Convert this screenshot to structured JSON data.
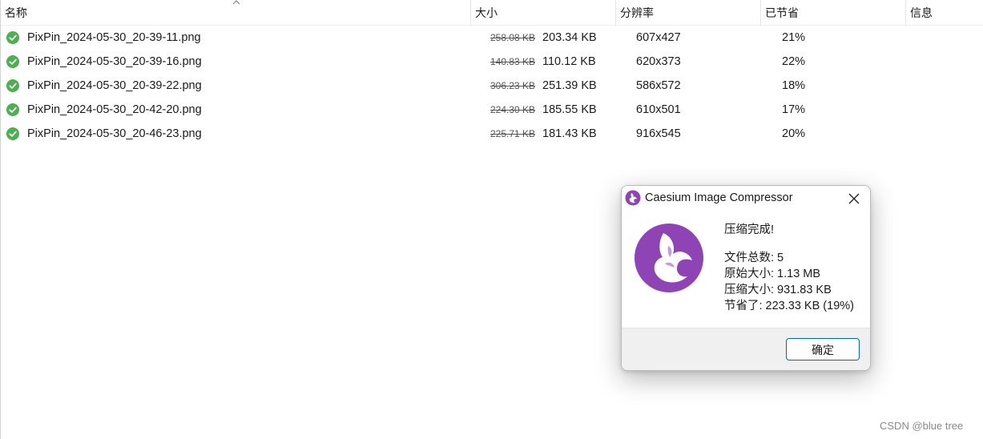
{
  "columns": {
    "name": "名称",
    "size": "大小",
    "resolution": "分辨率",
    "saved": "已节省",
    "info": "信息"
  },
  "files": [
    {
      "name": "PixPin_2024-05-30_20-39-11.png",
      "original_size": "258.08 KB",
      "compressed_size": "203.34 KB",
      "resolution": "607x427",
      "saved": "21%",
      "status": "success"
    },
    {
      "name": "PixPin_2024-05-30_20-39-16.png",
      "original_size": "140.83 KB",
      "compressed_size": "110.12 KB",
      "resolution": "620x373",
      "saved": "22%",
      "status": "success"
    },
    {
      "name": "PixPin_2024-05-30_20-39-22.png",
      "original_size": "306.23 KB",
      "compressed_size": "251.39 KB",
      "resolution": "586x572",
      "saved": "18%",
      "status": "success"
    },
    {
      "name": "PixPin_2024-05-30_20-42-20.png",
      "original_size": "224.30 KB",
      "compressed_size": "185.55 KB",
      "resolution": "610x501",
      "saved": "17%",
      "status": "success"
    },
    {
      "name": "PixPin_2024-05-30_20-46-23.png",
      "original_size": "225.71 KB",
      "compressed_size": "181.43 KB",
      "resolution": "916x545",
      "saved": "20%",
      "status": "success"
    }
  ],
  "dialog": {
    "title": "Caesium Image Compressor",
    "close_symbol": "✕",
    "headline": "压缩完成!",
    "total_files": "文件总数: 5",
    "original_size": "原始大小: 1.13 MB",
    "compressed_size": "压缩大小: 931.83 KB",
    "saved": "节省了: 223.33 KB (19%)",
    "ok_label": "确定"
  },
  "watermark": "CSDN @blue tree",
  "colors": {
    "success_green": "#4caf50",
    "brand_purple": "#8e44b5",
    "button_border": "#0067c0"
  }
}
